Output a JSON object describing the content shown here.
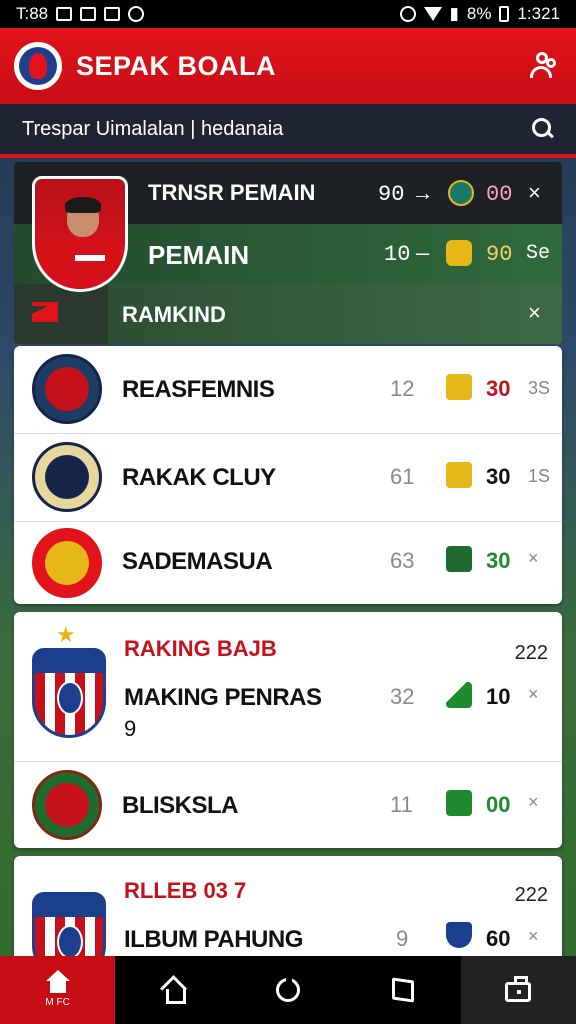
{
  "status_bar": {
    "time_left": "T:88",
    "battery": "8%",
    "time_right": "1:321"
  },
  "app": {
    "title": "SEPAK BOALA",
    "profile_icon": "users-icon"
  },
  "search": {
    "text": "Trespar Uimalalan | hedanaia",
    "icon": "search-icon"
  },
  "featured": {
    "row1": {
      "label": "TRNSR PEMAIN",
      "n1": "90",
      "sep": "→",
      "n2": "00",
      "close": "×"
    },
    "row2": {
      "label": "PEMAIN",
      "n1": "10",
      "sep": "—",
      "n2": "90",
      "n3": "Se"
    },
    "row3": {
      "label": "RAMKIND",
      "close": "×"
    }
  },
  "list1": [
    {
      "name": "REASFEMNIS",
      "n1": "12",
      "n2": "30",
      "n3": "3S",
      "n2_color": "#c5121a"
    },
    {
      "name": "RAKAK CLUY",
      "n1": "61",
      "n2": "30",
      "n3": "1S",
      "n2_color": "#111111"
    },
    {
      "name": "SADEMASUA",
      "n1": "63",
      "n2": "30",
      "n3": "×",
      "n2_color": "#1f8a2e"
    }
  ],
  "list2": {
    "title": "RAKING BAJB",
    "count": "222",
    "rows": [
      {
        "name": "MAKING PENRAS",
        "sub": "9",
        "n1": "32",
        "n2": "10",
        "n3": "×"
      },
      {
        "name": "BLISKSLA",
        "n1": "11",
        "n2": "00",
        "n3": "×",
        "n2_color": "#1f8a2e"
      }
    ]
  },
  "list3": {
    "title": "RLLEB 03 7",
    "count": "222",
    "row": {
      "name": "ILBUM PAHUNG",
      "n1": "9",
      "n2": "60",
      "n3": "×"
    }
  },
  "bottom_nav": [
    {
      "icon": "home-icon",
      "label": "M FC"
    },
    {
      "icon": "house-outline-icon",
      "label": ""
    },
    {
      "icon": "refresh-icon",
      "label": ""
    },
    {
      "icon": "chat-icon",
      "label": ""
    },
    {
      "icon": "briefcase-icon",
      "label": ""
    }
  ],
  "colors": {
    "brand_red": "#e1131b",
    "dark": "#1e2530",
    "green": "#1f8a2e"
  }
}
